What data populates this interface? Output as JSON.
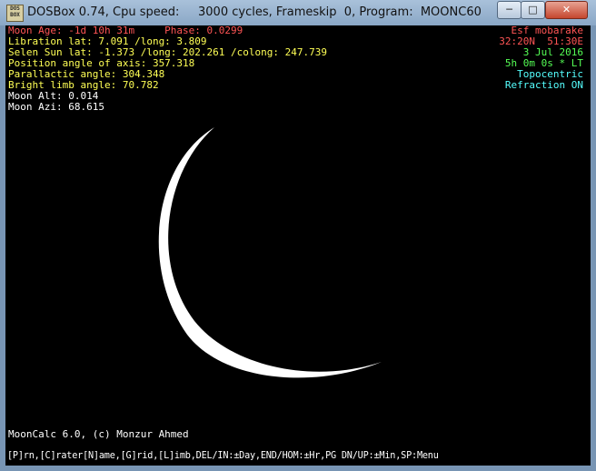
{
  "window": {
    "icon_text": "DOS BOX",
    "title": "DOSBox 0.74, Cpu speed:     3000 cycles, Frameskip  0, Program:  MOONC60",
    "minimize_label": "─",
    "maximize_label": "□",
    "close_label": "✕"
  },
  "info_left": [
    {
      "text": "Moon Age: -1d 10h 31m     Phase: 0.0299",
      "color": "#ff5555"
    },
    {
      "text": "Libration lat: 7.091 /long: 3.809",
      "color": "#ffff55"
    },
    {
      "text": "Selen Sun lat: -1.373 /long: 202.261 /colong: 247.739",
      "color": "#ffff55"
    },
    {
      "text": "Position angle of axis: 357.318",
      "color": "#ffff55"
    },
    {
      "text": "Parallactic angle: 304.348",
      "color": "#ffff55"
    },
    {
      "text": "Bright limb angle: 70.782",
      "color": "#ffff55"
    },
    {
      "text": "Moon Alt: 0.014",
      "color": "#ffffff"
    },
    {
      "text": "Moon Azi: 68.615",
      "color": "#ffffff"
    }
  ],
  "info_right": [
    {
      "text": "Esf mobarake",
      "color": "#ff5555"
    },
    {
      "text": "32:20N  51:30E",
      "color": "#ff5555"
    },
    {
      "text": "3 Jul 2016",
      "color": "#55ff55"
    },
    {
      "text": "5h 0m 0s * LT",
      "color": "#55ff55"
    },
    {
      "text": "Topocentric",
      "color": "#55ffff"
    },
    {
      "text": "Refraction ON",
      "color": "#55ffff"
    }
  ],
  "credit": "MoonCalc 6.0, (c) Monzur Ahmed",
  "hotkeys": "[P]rn,[C]rater[N]ame,[G]rid,[L]imb,DEL/IN:±Day,END/HOM:±Hr,PG DN/UP:±Min,SP:Menu",
  "moon": {
    "phase": 0.0299,
    "bright_limb_angle": 70.782,
    "crescent_color": "#ffffff"
  }
}
